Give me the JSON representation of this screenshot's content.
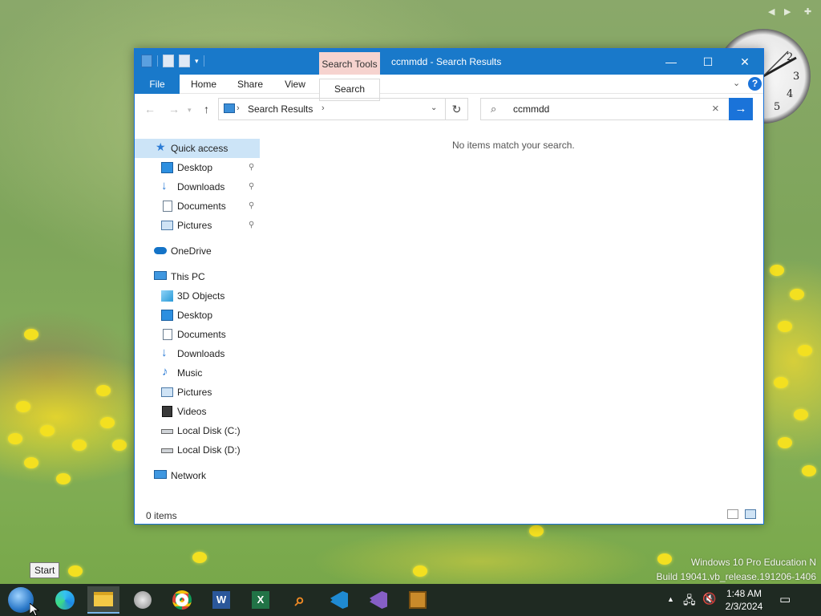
{
  "window": {
    "title": "ccmmdd - Search Results",
    "context_tab": "Search Tools",
    "minimize_glyph": "—",
    "maximize_glyph": "☐",
    "close_glyph": "✕"
  },
  "ribbon": {
    "tabs": [
      "File",
      "Home",
      "Share",
      "View",
      "Search"
    ],
    "help_glyph": "?"
  },
  "address": {
    "breadcrumb": "Search Results",
    "separator": "›"
  },
  "search": {
    "value": "ccmmdd"
  },
  "nav_pane": {
    "items": [
      {
        "label": "Quick access",
        "icon": "star-icon"
      },
      {
        "label": "Desktop",
        "icon": "desktop-icon",
        "pinned": true
      },
      {
        "label": "Downloads",
        "icon": "download-icon",
        "pinned": true
      },
      {
        "label": "Documents",
        "icon": "document-icon",
        "pinned": true
      },
      {
        "label": "Pictures",
        "icon": "pictures-icon",
        "pinned": true
      },
      {
        "label": "OneDrive",
        "icon": "cloud-icon"
      },
      {
        "label": "This PC",
        "icon": "computer-icon"
      },
      {
        "label": "3D Objects",
        "icon": "cube-icon"
      },
      {
        "label": "Desktop",
        "icon": "desktop-icon"
      },
      {
        "label": "Documents",
        "icon": "document-icon"
      },
      {
        "label": "Downloads",
        "icon": "download-icon"
      },
      {
        "label": "Music",
        "icon": "music-icon"
      },
      {
        "label": "Pictures",
        "icon": "pictures-icon"
      },
      {
        "label": "Videos",
        "icon": "video-icon"
      },
      {
        "label": "Local Disk (C:)",
        "icon": "drive-icon"
      },
      {
        "label": "Local Disk (D:)",
        "icon": "drive-icon"
      },
      {
        "label": "Network",
        "icon": "network-icon"
      }
    ],
    "pin_glyph": "📌"
  },
  "content": {
    "empty_message": "No items match your search."
  },
  "status_bar": {
    "item_count": "0 items"
  },
  "desktop": {
    "watermark_line1": "Windows 10 Pro Education N",
    "watermark_line2": "Build 19041.vb_release.191206-1406",
    "clock_numbers": [
      "2",
      "3",
      "4",
      "5"
    ]
  },
  "taskbar": {
    "start_tooltip": "Start",
    "apps": [
      "start",
      "edge",
      "file-explorer",
      "app-generic",
      "chrome",
      "word",
      "excel",
      "search-tool",
      "vscode",
      "visual-studio",
      "app-grid"
    ],
    "time": "1:48 AM",
    "date": "2/3/2024",
    "tray_arrow": "▲"
  },
  "colors": {
    "accent": "#1979ca",
    "context_tab": "#f6d3cf",
    "selection": "#cce4f7",
    "taskbar": "#1f2a22"
  }
}
